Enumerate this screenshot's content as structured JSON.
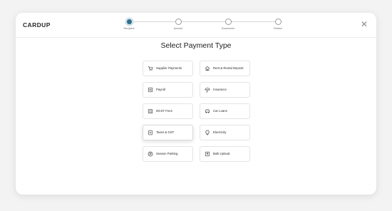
{
  "app": {
    "brand": "CARDUP"
  },
  "stepper": {
    "steps": [
      {
        "label": "Recipient",
        "active": true
      },
      {
        "label": "Amount",
        "active": false
      },
      {
        "label": "Documents",
        "active": false
      },
      {
        "label": "Review",
        "active": false
      }
    ]
  },
  "page": {
    "title": "Select Payment Type"
  },
  "payment_types": [
    {
      "label": "Supplier Payments",
      "icon": "cart-icon"
    },
    {
      "label": "Rent & Rental Deposit",
      "icon": "house-icon"
    },
    {
      "label": "Payroll",
      "icon": "payroll-icon"
    },
    {
      "label": "Insurance",
      "icon": "umbrella-icon"
    },
    {
      "label": "MCST Fees",
      "icon": "building-icon"
    },
    {
      "label": "Car Loans",
      "icon": "car-icon"
    },
    {
      "label": "Taxes & GST",
      "icon": "document-icon"
    },
    {
      "label": "Electricity",
      "icon": "bulb-icon"
    },
    {
      "label": "Season Parking",
      "icon": "parking-icon"
    },
    {
      "label": "Bulk Upload",
      "icon": "upload-icon"
    }
  ],
  "colors": {
    "accent": "#2f6f8c"
  }
}
